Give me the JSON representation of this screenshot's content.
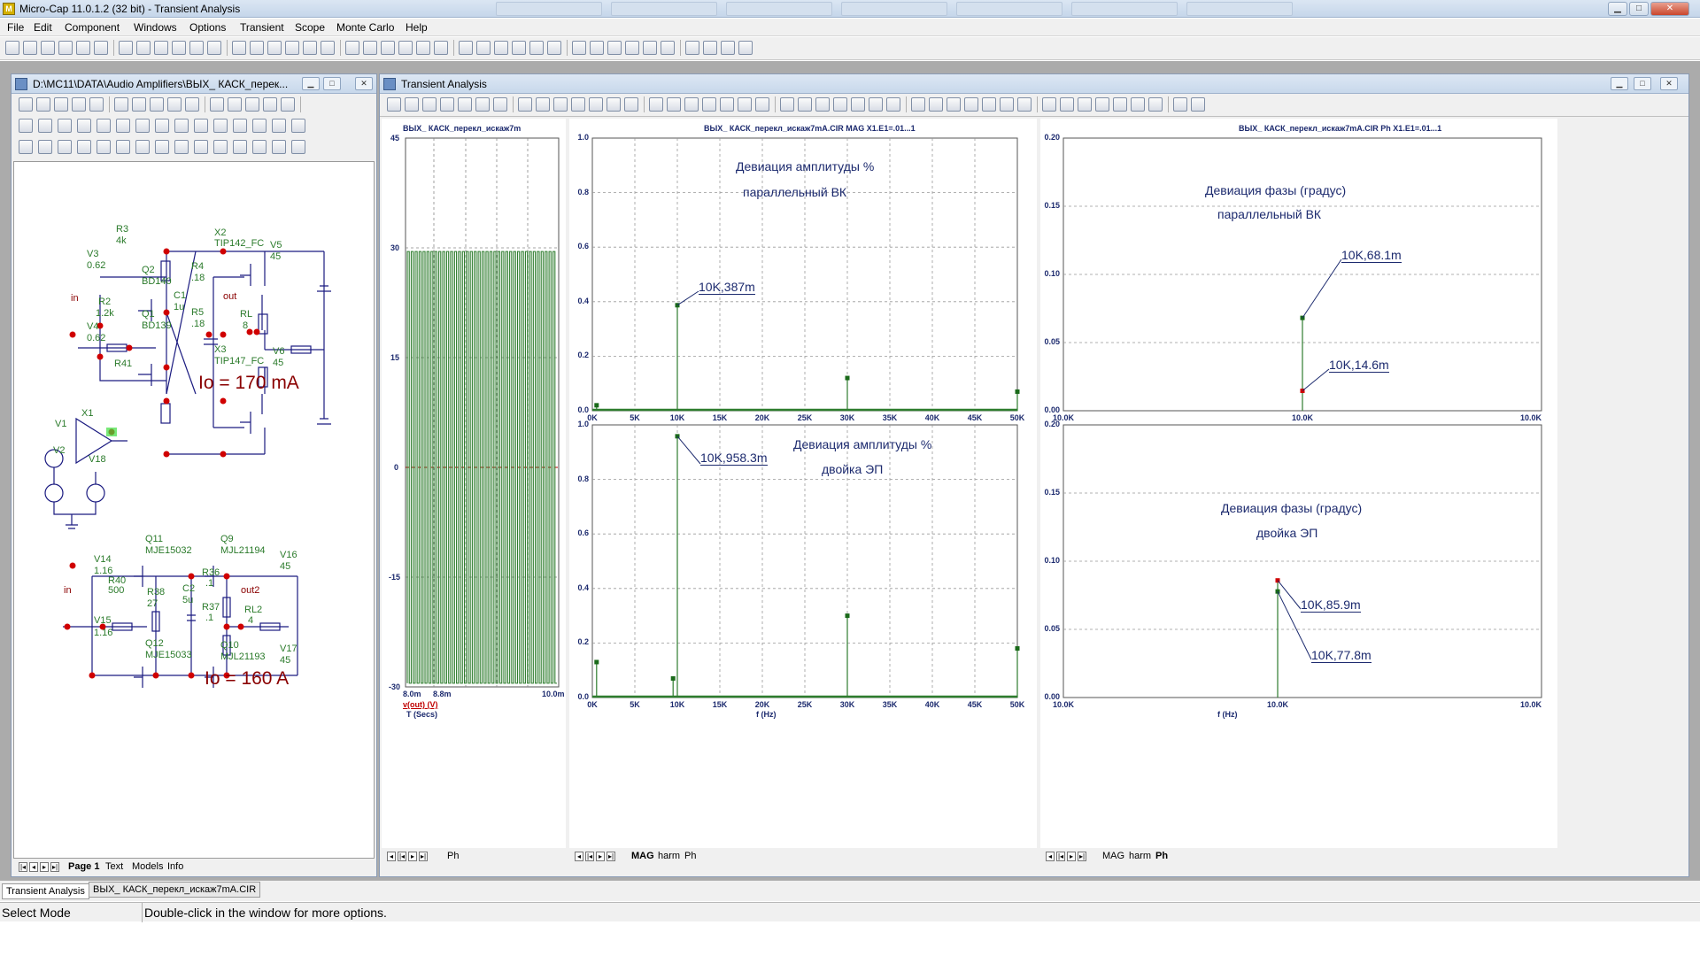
{
  "app": {
    "title": "Micro-Cap 11.0.1.2 (32 bit) - Transient Analysis"
  },
  "menu": [
    "File",
    "Edit",
    "Component",
    "Windows",
    "Options",
    "Transient",
    "Scope",
    "Monte Carlo",
    "Help"
  ],
  "schematic_window": {
    "title": "D:\\MC11\\DATA\\Audio Amplifiers\\ВЫХ_ КАСК_перек...",
    "labels_top": [
      "R3",
      "4k",
      "V3",
      "0.62",
      "Q2",
      "BD140",
      "in",
      "R2",
      "1.2k",
      "Q1",
      "BD139",
      "V4",
      "0.62",
      "R41",
      "X2",
      "TIP142_FC",
      "R4",
      ".18",
      "C1",
      "1u",
      "R5",
      ".18",
      "X3",
      "TIP147_FC",
      "out",
      "RL",
      "8",
      "V5",
      "45",
      "V6",
      "45"
    ],
    "io1": "Io = 170 mA",
    "misc_labels": [
      "X1",
      "V1",
      "V2",
      "V18"
    ],
    "labels_bottom": [
      "Q11",
      "MJE15032",
      "Q9",
      "MJL21194",
      "V14",
      "1.16",
      "R40",
      "500",
      "in",
      "R38",
      "27",
      "C2",
      "5u",
      "R36",
      ".1",
      "R37",
      ".1",
      "out2",
      "RL2",
      "4",
      "V16",
      "45",
      "V15",
      "1.16",
      "Q12",
      "MJE15033",
      "Q10",
      "MJL21193",
      "V17",
      "45"
    ],
    "io2": "Io = 160 A",
    "page_tabs": [
      "Page 1",
      "Text",
      "Models",
      "Info"
    ]
  },
  "analysis_window": {
    "title": "Transient Analysis",
    "waveform": {
      "title": "ВЫХ_ КАСК_перекл_искаж7m",
      "xticks": [
        "8.0m",
        "8.8m",
        "10.0m"
      ],
      "yticks": [
        "45",
        "30",
        "15",
        "0",
        "-15",
        "-30"
      ],
      "legend": "v(out) (V)",
      "xlabel": "T (Secs)",
      "tab": "Ph"
    },
    "mag": {
      "title": "ВЫХ_ КАСК_перекл_искаж7mA.CIR MAG X1.E1=.01...1",
      "top": {
        "ann1": "Девиация амплитуды %",
        "ann2": "параллельный ВК",
        "label": "10K,387m",
        "yticks": [
          "1.0",
          "0.8",
          "0.6",
          "0.4",
          "0.2",
          "0.0"
        ]
      },
      "bottom": {
        "ann1": "Девиация амплитуды %",
        "ann2": "двойка ЭП",
        "label": "10K,958.3m",
        "yticks": [
          "1.0",
          "0.8",
          "0.6",
          "0.4",
          "0.2",
          "0.0"
        ]
      },
      "xticks": [
        "0K",
        "5K",
        "10K",
        "15K",
        "20K",
        "25K",
        "30K",
        "35K",
        "40K",
        "45K",
        "50K"
      ],
      "xlabel": "f (Hz)",
      "tabs": [
        "MAG",
        "harm",
        "Ph"
      ]
    },
    "phase": {
      "title": "ВЫХ_ КАСК_перекл_искаж7mA.CIR Ph X1.E1=.01...1",
      "top": {
        "ann1": "Девиация фазы (градус)",
        "ann2": "параллельный ВК",
        "label1": "10K,68.1m",
        "label2": "10K,14.6m",
        "yticks": [
          "0.20",
          "0.15",
          "0.10",
          "0.05",
          "0.00"
        ]
      },
      "bottom": {
        "ann1": "Девиация фазы (градус)",
        "ann2": "двойка ЭП",
        "label1": "10K,85.9m",
        "label2": "10K,77.8m",
        "yticks": [
          "0.20",
          "0.15",
          "0.10",
          "0.05",
          "0.00"
        ]
      },
      "xticks": [
        "10.0K",
        "10.0K",
        "10.0K"
      ],
      "xlabel": "f (Hz)",
      "tabs": [
        "MAG",
        "harm",
        "Ph"
      ]
    }
  },
  "chart_data": [
    {
      "type": "line",
      "title": "ВЫХ_ КАСК_перекл_искаж7m",
      "xlabel": "T (Secs)",
      "ylabel": "",
      "ylim": [
        -30,
        45
      ],
      "xlim": [
        "8.0m",
        "10.0m"
      ],
      "series": [
        {
          "name": "v(out) (V)",
          "description_values": {
            "high": 29.5,
            "low": -29.5
          }
        }
      ]
    },
    {
      "type": "bar",
      "title": "ВЫХ_ КАСК_перекл_искаж7mA.CIR MAG X1.E1=.01...1",
      "xlabel": "f (Hz)",
      "ylim": [
        0,
        1
      ],
      "x": [
        500,
        10000,
        30000,
        50000
      ],
      "series": [
        {
          "values": [
            0.02,
            0.387,
            0.12,
            0.07
          ]
        }
      ]
    },
    {
      "type": "bar",
      "xlabel": "f (Hz)",
      "ylim": [
        0,
        1
      ],
      "x": [
        500,
        9500,
        10000,
        30000,
        50000
      ],
      "series": [
        {
          "values": [
            0.13,
            0.07,
            0.9583,
            0.3,
            0.18
          ]
        }
      ]
    },
    {
      "type": "bar",
      "title": "ВЫХ_ КАСК_перекл_искаж7mA.CIR Ph X1.E1=.01...1",
      "xlabel": "f (Hz)",
      "ylim": [
        0,
        0.2
      ],
      "x": [
        "10.0K",
        "10.0K"
      ],
      "series": [
        {
          "values": [
            0.0681,
            0.0146
          ]
        }
      ]
    },
    {
      "type": "bar",
      "xlabel": "f (Hz)",
      "ylim": [
        0,
        0.2
      ],
      "x": [
        "10.0K",
        "10.0K"
      ],
      "series": [
        {
          "values": [
            0.0859,
            0.0778
          ]
        }
      ]
    }
  ],
  "doc_tabs": [
    "Transient Analysis",
    "ВЫХ_ КАСК_перекл_искаж7mA.CIR"
  ],
  "status": {
    "mode": "Select Mode",
    "hint": "Double-click in the window for more options."
  }
}
